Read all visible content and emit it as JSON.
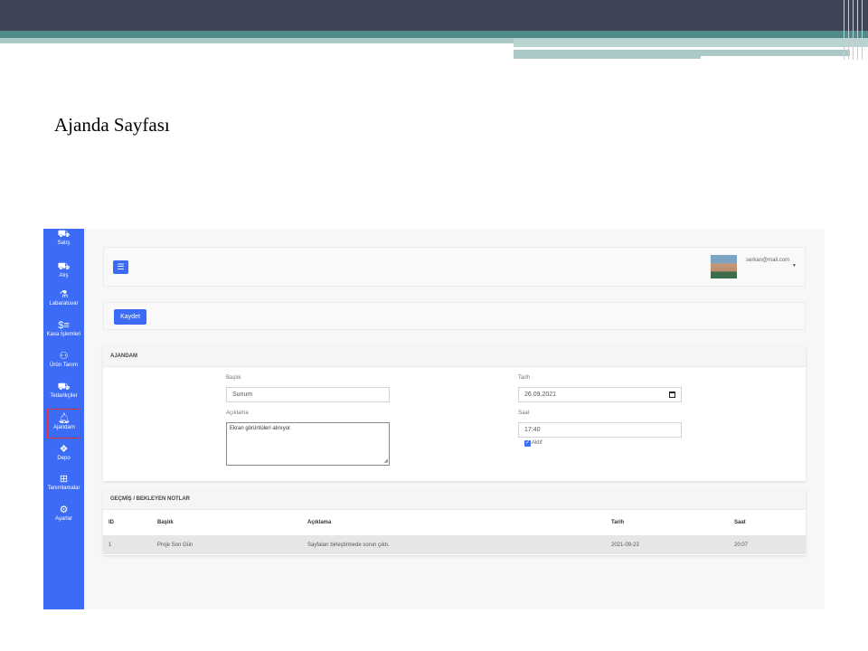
{
  "slide": {
    "title": "Ajanda Sayfası"
  },
  "sidebar": {
    "items": [
      {
        "label": "Satış",
        "icon": "basket-icon"
      },
      {
        "label": "Alış",
        "icon": "truck-icon"
      },
      {
        "label": "Labaratuvar",
        "icon": "flask-icon"
      },
      {
        "label": "Kasa İşlemleri",
        "icon": "money-icon"
      },
      {
        "label": "Ürün Tanım",
        "icon": "people-carry-icon"
      },
      {
        "label": "Tedarikçiler",
        "icon": "truck-icon"
      },
      {
        "label": "Ajandam",
        "icon": "bell-icon",
        "active": true
      },
      {
        "label": "Depo",
        "icon": "dropbox-icon"
      },
      {
        "label": "Tanımlamalar",
        "icon": "plus-square-icon"
      },
      {
        "label": "Ayarlar",
        "icon": "gear-icon"
      }
    ]
  },
  "topbar": {
    "menu_icon": "☰",
    "user_email": "serkan@mail.com"
  },
  "toolbar": {
    "save_label": "Kaydet"
  },
  "form": {
    "header": "AJANDAM",
    "baslik_label": "Başlık",
    "baslik_value": "Sunum",
    "aciklama_label": "Açıklama",
    "aciklama_value": "Ekran görüntüleri alınıyor.",
    "tarih_label": "Tarih",
    "tarih_value": "26.09.2021",
    "saat_label": "Saat",
    "saat_value": "17:40",
    "aktif_label": "Aktif",
    "aktif_checked": true
  },
  "notes": {
    "header": "GEÇMİŞ / BEKLEYEN NOTLAR",
    "columns": [
      "ID",
      "Başlık",
      "Açıklama",
      "Tarih",
      "Saat"
    ],
    "rows": [
      [
        "1",
        "Proje Son Gün",
        "Sayfaları birleştirmede sorun çıktı.",
        "2021-09-23",
        "20:07"
      ]
    ]
  },
  "colors": {
    "accent": "#3c6cf5",
    "header_dark": "#3f4456",
    "teal": "#4f8a88"
  }
}
